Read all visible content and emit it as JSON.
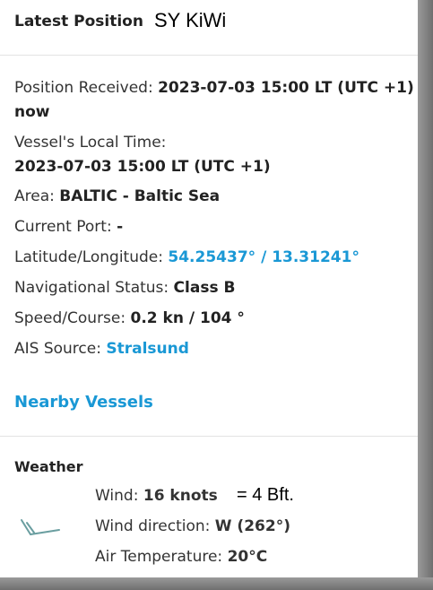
{
  "header": {
    "title": "Latest Position",
    "vessel_name": "SY KiWi"
  },
  "position": {
    "received_label": "Position Received:",
    "received_value": "2023-07-03 15:00 LT (UTC +1)",
    "received_relative": "now",
    "local_time_label": "Vessel's Local Time:",
    "local_time_value": "2023-07-03 15:00 LT (UTC +1)",
    "area_label": "Area:",
    "area_value": "BALTIC - Baltic Sea",
    "port_label": "Current Port:",
    "port_value": "-",
    "latlon_label": "Latitude/Longitude:",
    "latlon_value": "54.25437° / 13.31241°",
    "nav_status_label": "Navigational Status:",
    "nav_status_value": "Class B",
    "speed_label": "Speed/Course:",
    "speed_value": "0.2 kn / 104 °",
    "ais_label": "AIS Source:",
    "ais_value": "Stralsund"
  },
  "nearby": {
    "label": "Nearby Vessels"
  },
  "weather": {
    "title": "Weather",
    "wind_label": "Wind:",
    "wind_value": "16 knots",
    "wind_bft_note": "= 4 Bft.",
    "direction_label": "Wind direction:",
    "direction_value": "W (262°)",
    "temp_label": "Air Temperature:",
    "temp_value": "20°C",
    "icon": "wind-barb-icon"
  },
  "colors": {
    "link": "#1a98d5",
    "text": "#333333",
    "shadow": "#808080"
  }
}
